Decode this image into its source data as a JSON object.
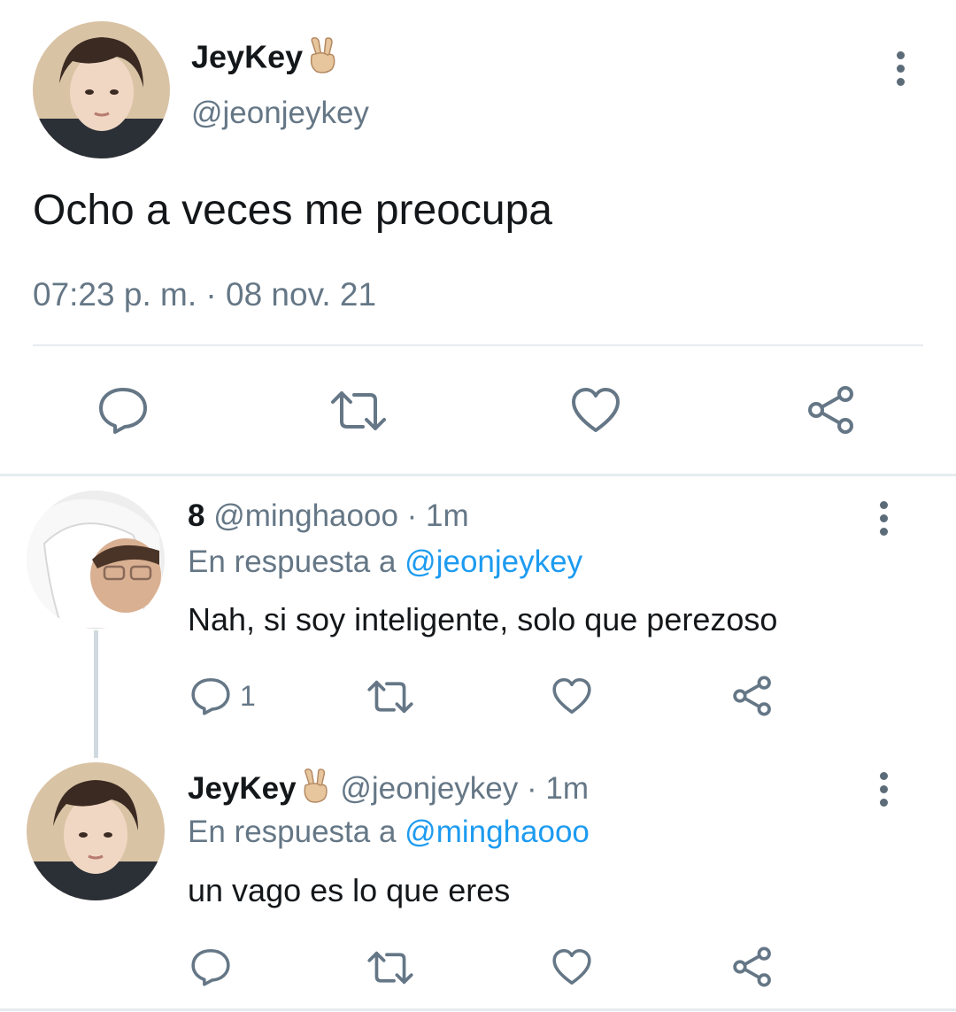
{
  "main_tweet": {
    "display_name": "JeyKey",
    "emoji_icon": "peace-hand-icon",
    "handle": "@jeonjeykey",
    "text": "Ocho a veces me preocupa",
    "timestamp": "07:23 p. m. · 08 nov. 21"
  },
  "replies": [
    {
      "display_name": "8",
      "handle": "@minghaooo",
      "time": "· 1m",
      "reply_prefix": "En respuesta a",
      "reply_to": "@jeonjeykey",
      "text": "Nah, si soy inteligente, solo que perezoso",
      "reply_count": "1"
    },
    {
      "display_name": "JeyKey",
      "emoji_icon": "peace-hand-icon",
      "handle": "@jeonjeykey",
      "time": "· 1m",
      "reply_prefix": "En respuesta a",
      "reply_to": "@minghaooo",
      "text": "un vago es lo que eres",
      "reply_count": ""
    }
  ],
  "colors": {
    "link": "#1d9bf0",
    "muted": "#657786",
    "divider": "#e6ecf0"
  }
}
